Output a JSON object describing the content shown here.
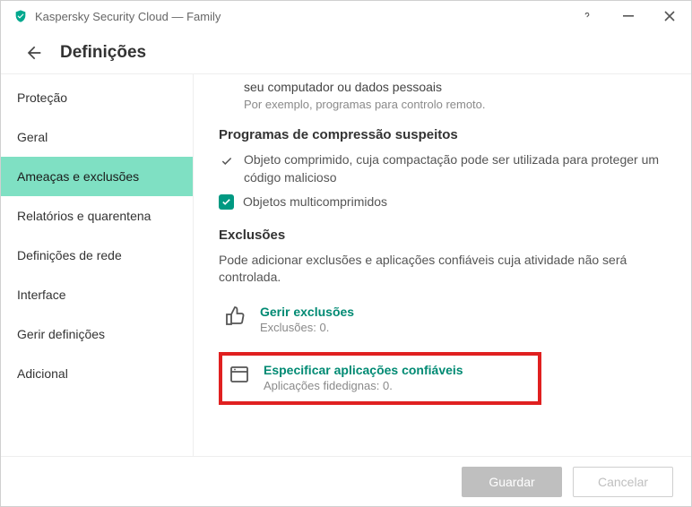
{
  "window": {
    "title": "Kaspersky Security Cloud — Family"
  },
  "header": {
    "title": "Definições"
  },
  "sidebar": {
    "items": [
      {
        "label": "Proteção"
      },
      {
        "label": "Geral"
      },
      {
        "label": "Ameaças e exclusões"
      },
      {
        "label": "Relatórios e quarentena"
      },
      {
        "label": "Definições de rede"
      },
      {
        "label": "Interface"
      },
      {
        "label": "Gerir definições"
      },
      {
        "label": "Adicional"
      }
    ],
    "active_index": 2
  },
  "content": {
    "fragment_line": "seu computador ou dados pessoais",
    "fragment_hint": "Por exemplo, programas para controlo remoto.",
    "compress_title": "Programas de compressão suspeitos",
    "compress_row1": "Objeto comprimido, cuja compactação pode ser utilizada para proteger um código malicioso",
    "compress_row2": "Objetos multicomprimidos",
    "exclusions_title": "Exclusões",
    "exclusions_desc": "Pode adicionar exclusões e aplicações confiáveis cuja atividade não será controlada.",
    "manage_exclusions": {
      "title": "Gerir exclusões",
      "sub": "Exclusões: 0."
    },
    "trusted_apps": {
      "title": "Especificar aplicações confiáveis",
      "sub": "Aplicações fidedignas: 0."
    }
  },
  "footer": {
    "save": "Guardar",
    "cancel": "Cancelar"
  }
}
